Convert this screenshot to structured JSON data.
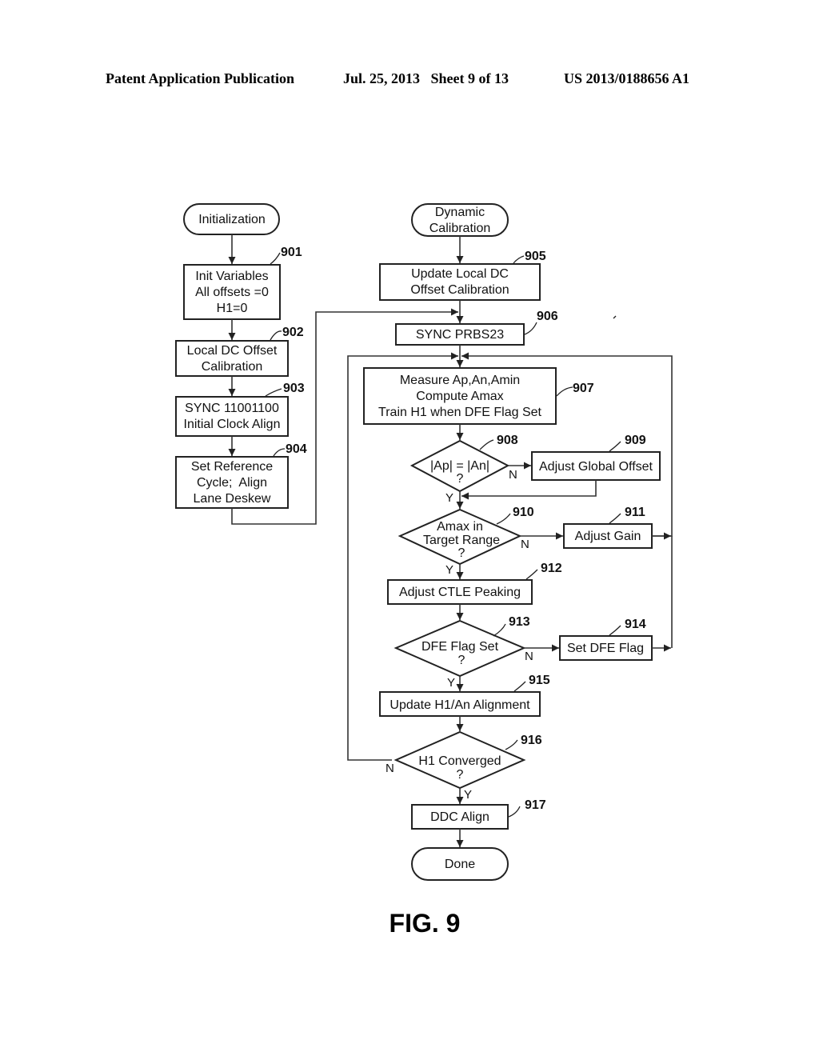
{
  "header": {
    "publication": "Patent Application Publication",
    "date_sheet": "Jul. 25, 2013   Sheet 9 of 13",
    "number": "US 2013/0188656 A1"
  },
  "figure_label": "FIG. 9",
  "flowchart": {
    "left_column": {
      "start": "Initialization",
      "steps": [
        {
          "ref": "901",
          "lines": [
            "Init Variables",
            "All offsets =0",
            "H1=0"
          ]
        },
        {
          "ref": "902",
          "lines": [
            "Local DC Offset",
            "Calibration"
          ]
        },
        {
          "ref": "903",
          "lines": [
            "SYNC 11001100",
            "Initial Clock Align"
          ]
        },
        {
          "ref": "904",
          "lines": [
            "Set Reference",
            "Cycle;  Align",
            "Lane Deskew"
          ]
        }
      ]
    },
    "right_column": {
      "start": [
        "Dynamic",
        "Calibration"
      ],
      "steps": [
        {
          "ref": "905",
          "type": "process",
          "lines": [
            "Update Local DC",
            "Offset Calibration"
          ]
        },
        {
          "ref": "906",
          "type": "process",
          "lines": [
            "SYNC PRBS23"
          ]
        },
        {
          "ref": "907",
          "type": "process",
          "lines": [
            "Measure Ap,An,Amin",
            "Compute Amax",
            "Train H1 when DFE Flag Set"
          ]
        },
        {
          "ref": "908",
          "type": "decision",
          "lines": [
            "|Ap| = |An|",
            "?"
          ],
          "yes": "Y",
          "no": "N"
        },
        {
          "ref": "909",
          "type": "process",
          "lines": [
            "Adjust Global Offset"
          ]
        },
        {
          "ref": "910",
          "type": "decision",
          "lines": [
            "Amax in",
            "Target Range",
            "?"
          ],
          "yes": "Y",
          "no": "N"
        },
        {
          "ref": "911",
          "type": "process",
          "lines": [
            "Adjust Gain"
          ]
        },
        {
          "ref": "912",
          "type": "process",
          "lines": [
            "Adjust CTLE Peaking"
          ]
        },
        {
          "ref": "913",
          "type": "decision",
          "lines": [
            "DFE Flag Set",
            "?"
          ],
          "yes": "Y",
          "no": "N"
        },
        {
          "ref": "914",
          "type": "process",
          "lines": [
            "Set DFE Flag"
          ]
        },
        {
          "ref": "915",
          "type": "process",
          "lines": [
            "Update H1/An Alignment"
          ]
        },
        {
          "ref": "916",
          "type": "decision",
          "lines": [
            "H1 Converged",
            "?"
          ],
          "yes": "Y",
          "no": "N"
        },
        {
          "ref": "917",
          "type": "process",
          "lines": [
            "DDC Align"
          ]
        }
      ],
      "end": "Done"
    }
  }
}
